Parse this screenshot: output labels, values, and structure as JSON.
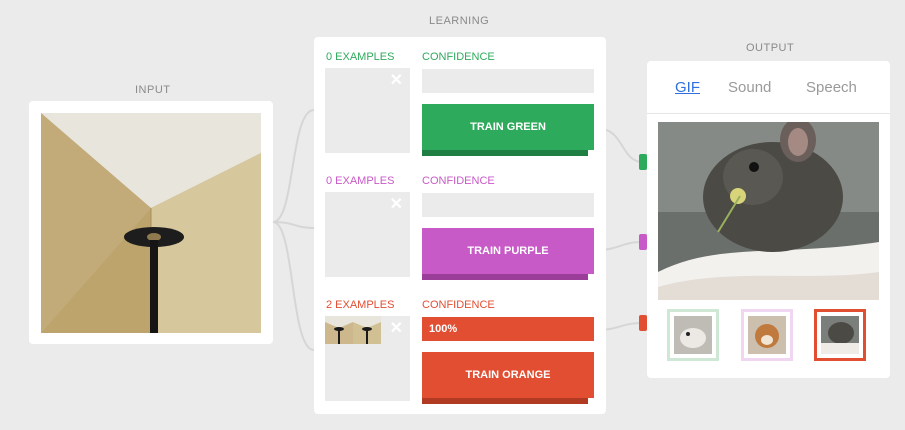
{
  "sections": {
    "input": "INPUT",
    "learning": "LEARNING",
    "output": "OUTPUT"
  },
  "classes": [
    {
      "examples_label": "0 EXAMPLES",
      "confidence_label": "CONFIDENCE",
      "confidence_value": "",
      "confidence": 0,
      "train_label": "TRAIN GREEN",
      "color": "#2eaa5c",
      "dark": "#1f7f43"
    },
    {
      "examples_label": "0 EXAMPLES",
      "confidence_label": "CONFIDENCE",
      "confidence_value": "",
      "confidence": 0,
      "train_label": "TRAIN PURPLE",
      "color": "#c85ac8",
      "dark": "#9a3e9a"
    },
    {
      "examples_label": "2 EXAMPLES",
      "confidence_label": "CONFIDENCE",
      "confidence_value": "100%",
      "confidence": 1,
      "train_label": "TRAIN ORANGE",
      "color": "#e24e32",
      "dark": "#b13a23"
    }
  ],
  "output": {
    "tabs": [
      "GIF",
      "Sound",
      "Speech"
    ],
    "active_tab": "GIF"
  },
  "icons": {
    "remove": "close-icon"
  }
}
